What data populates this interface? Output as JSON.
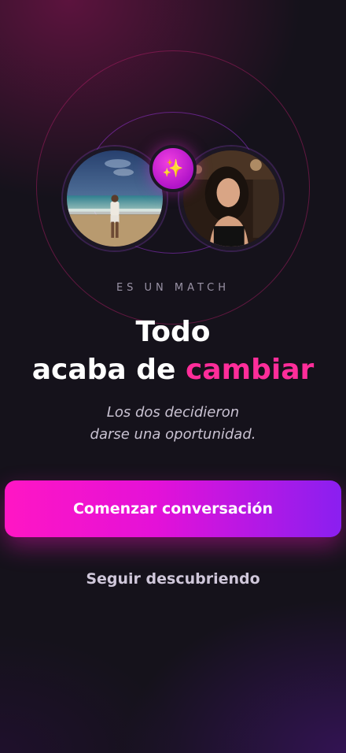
{
  "match": {
    "kicker": "ES UN MATCH",
    "title_line1": "Todo",
    "title_line2_prefix": "acaba de ",
    "title_line2_accent": "cambiar",
    "subtitle_line1": "Los dos decidieron",
    "subtitle_line2": "darse una oportunidad.",
    "badge_icon": "sparkles-icon"
  },
  "actions": {
    "primary_label": "Comenzar conversación",
    "secondary_label": "Seguir descubriendo"
  },
  "colors": {
    "accent": "#ff2d9a",
    "button_start": "#ff16c4",
    "button_end": "#8a1ff0",
    "background": "#15121b"
  }
}
